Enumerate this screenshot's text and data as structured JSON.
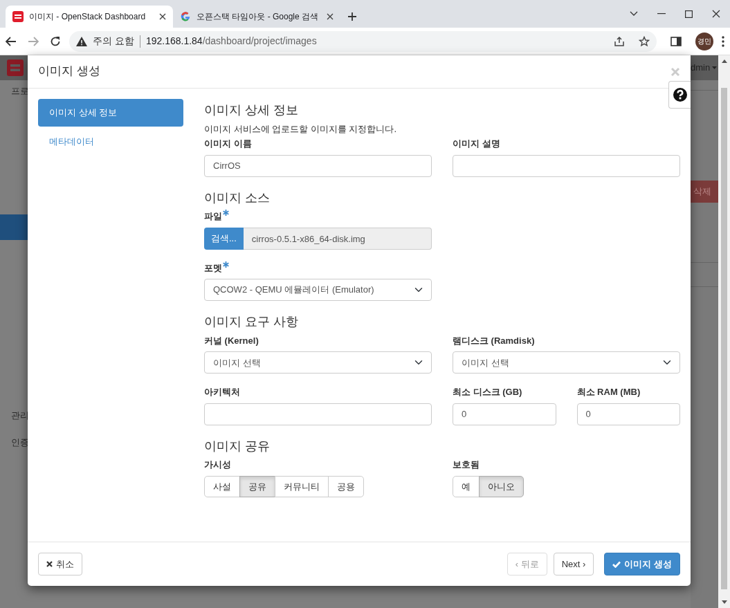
{
  "browser": {
    "tabs": [
      {
        "title": "이미지 - OpenStack Dashboard",
        "selected": true
      },
      {
        "title": "오픈스택 타임아웃 - Google 검색",
        "selected": false
      }
    ],
    "address": {
      "security": "주의 요함",
      "host": "192.168.1.84",
      "path": "/dashboard/project/images"
    },
    "profile": "경민"
  },
  "background": {
    "nav_items": [
      "프로",
      "관리",
      "인증"
    ],
    "user_menu": "dmin",
    "delete_button": "삭제"
  },
  "modal": {
    "title": "이미지 생성",
    "steps": [
      {
        "label": "이미지 상세 정보",
        "selected": true
      },
      {
        "label": "메타데이터",
        "selected": false
      }
    ],
    "sections": [
      {
        "title": "이미지 상세 정보",
        "description": "이미지 서비스에 업로드할 이미지를 지정합니다.",
        "rows": [
          [
            {
              "kind": "text",
              "label": "이미지 이름",
              "required": false,
              "value": "CirrOS"
            },
            {
              "kind": "text",
              "label": "이미지 설명",
              "required": false
            }
          ]
        ]
      },
      {
        "title": "이미지 소스",
        "rows": [
          [
            {
              "kind": "file",
              "label": "파일",
              "required": true,
              "button": "검색...",
              "value": "cirros-0.5.1-x86_64-disk.img"
            }
          ],
          [
            {
              "kind": "select",
              "label": "포멧",
              "required": true,
              "value": "QCOW2 - QEMU 에뮬레이터 (Emulator)"
            }
          ]
        ]
      },
      {
        "title": "이미지 요구 사항",
        "rows": [
          [
            {
              "kind": "select",
              "label": "커널 (Kernel)",
              "required": false,
              "value": "이미지 선택"
            },
            {
              "kind": "select",
              "label": "램디스크 (Ramdisk)",
              "required": false,
              "value": "이미지 선택"
            }
          ],
          [
            {
              "kind": "text",
              "label": "아키텍처",
              "required": false
            },
            {
              "kind": "pair",
              "fields": [
                {
                  "kind": "text",
                  "label": "최소 디스크 (GB)",
                  "required": false,
                  "value": "0"
                },
                {
                  "kind": "text",
                  "label": "최소 RAM (MB)",
                  "required": false,
                  "value": "0"
                }
              ]
            }
          ]
        ]
      },
      {
        "title": "이미지 공유",
        "rows": [
          [
            {
              "kind": "buttons",
              "label": "가시성",
              "required": false,
              "options": [
                {
                  "label": "사설",
                  "selected": false
                },
                {
                  "label": "공유",
                  "selected": true
                },
                {
                  "label": "커뮤니티",
                  "selected": false
                },
                {
                  "label": "공용",
                  "selected": false
                }
              ]
            },
            {
              "kind": "buttons",
              "label": "보호됨",
              "required": false,
              "options": [
                {
                  "label": "예",
                  "selected": false
                },
                {
                  "label": "아니오",
                  "selected": true
                }
              ]
            }
          ]
        ]
      }
    ],
    "footer": {
      "cancel": "취소",
      "back": {
        "label": "‹ 뒤로",
        "disabled": true
      },
      "next": {
        "label": "Next ›",
        "disabled": false
      },
      "submit": "이미지 생성"
    }
  }
}
